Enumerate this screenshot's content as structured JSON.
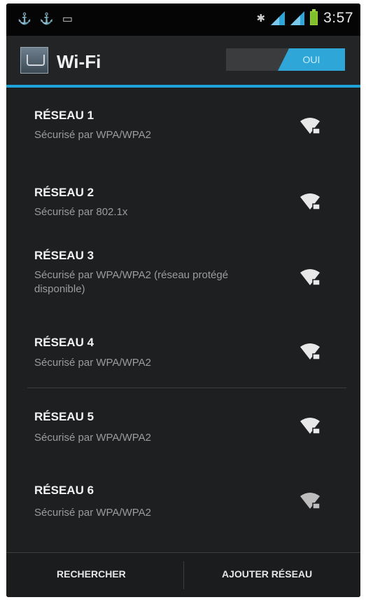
{
  "status_bar": {
    "time": "3:57",
    "left_icons": [
      "usb-icon",
      "usb-icon",
      "image-icon"
    ],
    "right_icons": [
      "bluetooth-icon",
      "signal-icon",
      "signal-icon",
      "battery-icon"
    ],
    "battery_color": "#7fbf2b"
  },
  "action_bar": {
    "title": "Wi-Fi",
    "toggle_label": "OUI",
    "accent_color": "#1ea3d8"
  },
  "networks": [
    {
      "name": "RÉSEAU 1",
      "security": "Sécurisé par WPA/WPA2"
    },
    {
      "name": "RÉSEAU 2",
      "security": "Sécurisé par 802.1x"
    },
    {
      "name": "RÉSEAU 3",
      "security": "Sécurisé par WPA/WPA2 (réseau protégé disponible)"
    },
    {
      "name": "RÉSEAU 4",
      "security": "Sécurisé par WPA/WPA2"
    },
    {
      "name": "RÉSEAU 5",
      "security": "Sécurisé par WPA/WPA2"
    },
    {
      "name": "RÉSEAU 6",
      "security": "Sécurisé par WPA/WPA2"
    }
  ],
  "bottom_bar": {
    "search_label": "RECHERCHER",
    "add_label": "AJOUTER RÉSEAU"
  }
}
